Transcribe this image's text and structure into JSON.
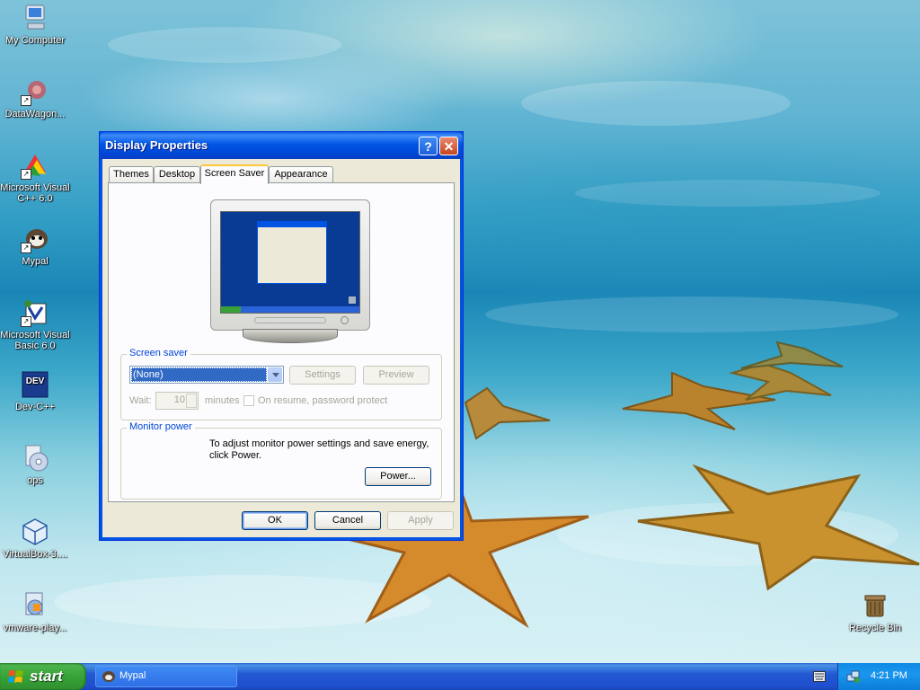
{
  "desktop_icons": [
    {
      "label": "My Computer",
      "icon": "computer-icon"
    },
    {
      "label": "DataWagon...",
      "icon": "datawagon-icon"
    },
    {
      "label": "Microsoft Visual C++ 6.0",
      "icon": "visual-cpp-icon"
    },
    {
      "label": "Mypal",
      "icon": "mypal-icon"
    },
    {
      "label": "Microsoft Visual Basic 6.0",
      "icon": "visual-basic-icon"
    },
    {
      "label": "Dev-C++",
      "icon": "devcpp-icon"
    },
    {
      "label": "ops",
      "icon": "cd-icon"
    },
    {
      "label": "VirtualBox-3....",
      "icon": "virtualbox-icon"
    },
    {
      "label": "vmware-play...",
      "icon": "vmware-icon"
    },
    {
      "label": "Recycle Bin",
      "icon": "recycle-bin-icon"
    }
  ],
  "dialog": {
    "title": "Display Properties",
    "help_label": "?",
    "close_label": "✕",
    "tabs": [
      {
        "label": "Themes"
      },
      {
        "label": "Desktop"
      },
      {
        "label": "Screen Saver",
        "active": true
      },
      {
        "label": "Appearance"
      }
    ],
    "screen_saver": {
      "group_label": "Screen saver",
      "selected": "(None)",
      "settings_label": "Settings",
      "preview_label": "Preview",
      "wait_label": "Wait:",
      "wait_value": "10",
      "minutes_label": "minutes",
      "resume_label": "On resume, password protect"
    },
    "monitor_power": {
      "group_label": "Monitor power",
      "description": "To adjust monitor power settings and save energy, click Power.",
      "power_label": "Power..."
    },
    "ok_label": "OK",
    "cancel_label": "Cancel",
    "apply_label": "Apply"
  },
  "taskbar": {
    "start_label": "start",
    "tasks": [
      {
        "label": "Mypal",
        "icon": "mypal-icon"
      }
    ],
    "clock": "4:21 PM"
  },
  "colors": {
    "xp_blue": "#0054e3",
    "start_green": "#37a337",
    "group_label_blue": "#0046d5",
    "selection_blue": "#316ac5"
  }
}
